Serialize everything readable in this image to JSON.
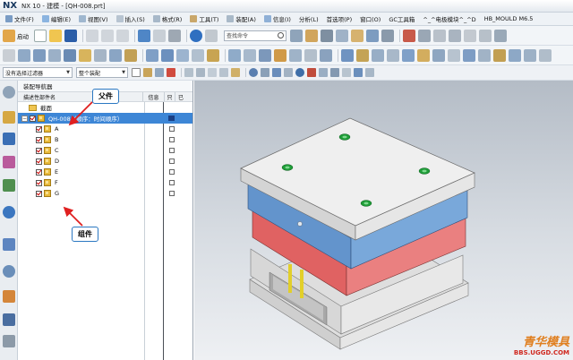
{
  "window": {
    "app": "NX",
    "title": "NX 10 - 建模 - [QH-008.prt]"
  },
  "menu": [
    "文件(F)",
    "编辑(E)",
    "视图(V)",
    "插入(S)",
    "格式(R)",
    "工具(T)",
    "装配(A)",
    "信息(I)",
    "分析(L)",
    "首选项(P)",
    "窗口(O)",
    "GC工具箱",
    "^_^电极模块^_^D",
    "HB_MOULD M6.5"
  ],
  "toolbar": {
    "start_label": "启动",
    "search_placeholder": "查找命令",
    "filter_select": "没有选择过滤器",
    "assembly_select": "整个装配"
  },
  "navigator": {
    "title": "装配导航器",
    "columns": {
      "name": "描述性部件名",
      "info": "信息",
      "readonly": "只",
      "modified": "已"
    },
    "section": "截面",
    "root": "QH-008（顺序：时间顺序）",
    "components": [
      "A",
      "B",
      "C",
      "D",
      "E",
      "F",
      "G"
    ]
  },
  "annotations": {
    "parent": "父件",
    "component": "组件"
  },
  "watermark": {
    "brand": "青华模具",
    "url": "BBS.UGGD.COM"
  },
  "colors": {
    "plate_top": "#e8e8e8",
    "plate_blue": "#6f9fd3",
    "plate_red": "#e86c6c",
    "plate_grey": "#d9d9d9",
    "selection": "#3d86d6",
    "green_marker": "#22a83a"
  }
}
